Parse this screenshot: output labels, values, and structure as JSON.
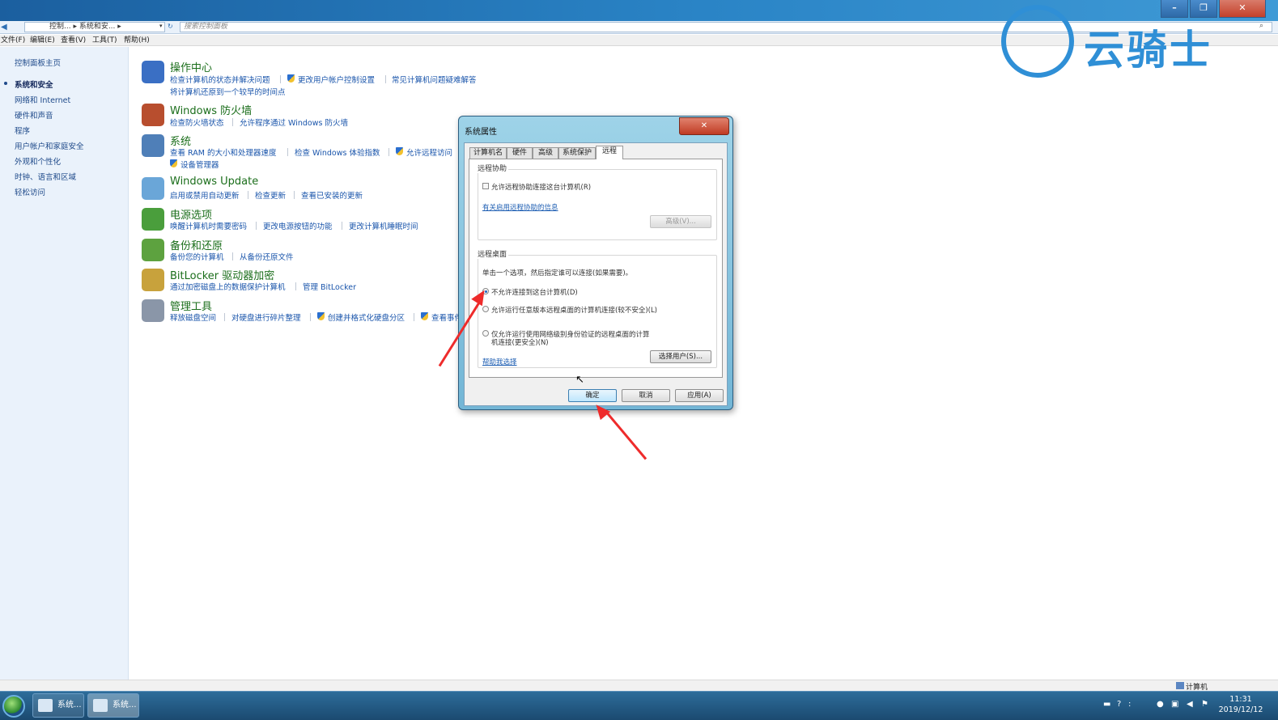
{
  "window": {
    "min_label": "–",
    "max_label": "❐",
    "close_label": "✕",
    "watermark_text": "云骑士"
  },
  "address": {
    "back_glyph": "◀",
    "path_text": "控制... ▸ 系统和安... ▸",
    "dropdown_glyph": "▾",
    "refresh_glyph": "↻",
    "search_placeholder": "搜索控制面板",
    "search_glyph": "⌕"
  },
  "menu": {
    "file": "文件(F)",
    "edit": "编辑(E)",
    "view": "查看(V)",
    "tools": "工具(T)",
    "help": "帮助(H)"
  },
  "sidebar": {
    "items": [
      {
        "label": "控制面板主页"
      },
      {
        "label": "系统和安全"
      },
      {
        "label": "网络和 Internet"
      },
      {
        "label": "硬件和声音"
      },
      {
        "label": "程序"
      },
      {
        "label": "用户帐户和家庭安全"
      },
      {
        "label": "外观和个性化"
      },
      {
        "label": "时钟、语言和区域"
      },
      {
        "label": "轻松访问"
      }
    ]
  },
  "categories": [
    {
      "title": "操作中心",
      "icon": "flag-icon",
      "color": "#3a6fc4",
      "links": [
        "检查计算机的状态并解决问题",
        "更改用户帐户控制设置",
        "常见计算机问题疑难解答",
        "将计算机还原到一个较早的时间点"
      ]
    },
    {
      "title": "Windows 防火墙",
      "icon": "firewall-icon",
      "color": "#b84e2e",
      "links": [
        "检查防火墙状态",
        "允许程序通过 Windows 防火墙"
      ]
    },
    {
      "title": "系统",
      "icon": "computer-icon",
      "color": "#4f7fb8",
      "links": [
        "查看 RAM 的大小和处理器速度",
        "检查 Windows 体验指数",
        "允许远程访问",
        "设备管理器"
      ]
    },
    {
      "title": "Windows Update",
      "icon": "update-icon",
      "color": "#6aa6d8",
      "links": [
        "启用或禁用自动更新",
        "检查更新",
        "查看已安装的更新"
      ]
    },
    {
      "title": "电源选项",
      "icon": "power-icon",
      "color": "#4a9e3c",
      "links": [
        "唤醒计算机时需要密码",
        "更改电源按钮的功能",
        "更改计算机睡眠时间"
      ]
    },
    {
      "title": "备份和还原",
      "icon": "backup-icon",
      "color": "#5da23f",
      "links": [
        "备份您的计算机",
        "从备份还原文件"
      ]
    },
    {
      "title": "BitLocker 驱动器加密",
      "icon": "bitlocker-icon",
      "color": "#c8a23c",
      "links": [
        "通过加密磁盘上的数据保护计算机",
        "管理 BitLocker"
      ]
    },
    {
      "title": "管理工具",
      "icon": "admin-tools-icon",
      "color": "#8a96a8",
      "links": [
        "释放磁盘空间",
        "对硬盘进行碎片整理",
        "创建并格式化硬盘分区",
        "查看事件"
      ]
    }
  ],
  "dialog": {
    "title": "系统属性",
    "close_label": "✕",
    "tabs": [
      {
        "label": "计算机名"
      },
      {
        "label": "硬件"
      },
      {
        "label": "高级"
      },
      {
        "label": "系统保护"
      },
      {
        "label": "远程"
      }
    ],
    "remote_assistance": {
      "title": "远程协助",
      "checkbox_label": "允许远程协助连接这台计算机(R)",
      "link": "有关启用远程协助的信息",
      "advanced_button": "高级(V)..."
    },
    "remote_desktop": {
      "title": "远程桌面",
      "description": "单击一个选项，然后指定谁可以连接(如果需要)。",
      "option1": "不允许连接到这台计算机(D)",
      "option2": "允许运行任意版本远程桌面的计算机连接(较不安全)(L)",
      "option3_line1": "仅允许运行使用网络级别身份验证的远程桌面的计算",
      "option3_line2": "机连接(更安全)(N)",
      "help_link": "帮助我选择",
      "select_users_button": "选择用户(S)..."
    },
    "buttons": {
      "ok": "确定",
      "cancel": "取消",
      "apply": "应用(A)"
    }
  },
  "statusbar": {
    "computer_label": "计算机"
  },
  "taskbar": {
    "buttons": [
      {
        "label": "系统..."
      },
      {
        "label": "系统..."
      }
    ],
    "time": "11:31",
    "date": "2019/12/12"
  },
  "colors": {
    "annotation_arrow": "#ee2b2b",
    "link": "#1a55ab",
    "category_title": "#1b6e1b"
  }
}
